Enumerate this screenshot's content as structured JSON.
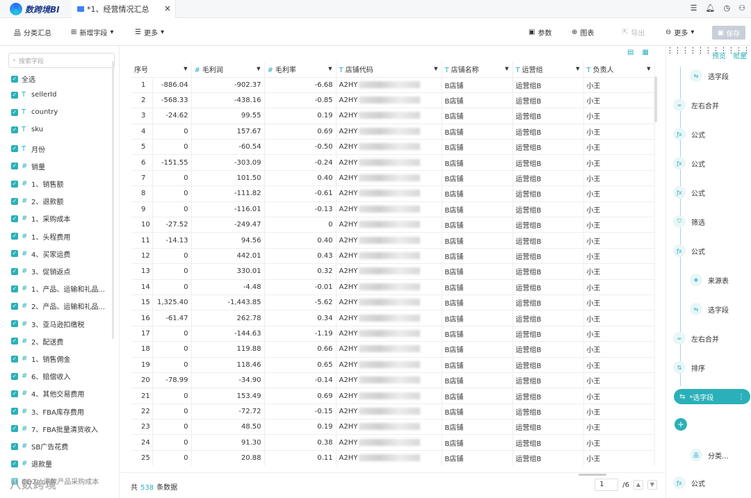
{
  "app": {
    "name": "数跨境BI"
  },
  "tab": {
    "title": "*1、经营情况汇总",
    "close": "×"
  },
  "toolbar": {
    "summary": "分类汇总",
    "add_field": "新增字段",
    "more1": "更多",
    "params": "参数",
    "chart": "图表",
    "export": "导出",
    "more2": "更多",
    "save": "保存"
  },
  "sidebar": {
    "search_placeholder": "搜索字段",
    "select_all": "全选",
    "fields": [
      {
        "type": "T",
        "name": "sellerId"
      },
      {
        "type": "T",
        "name": "country"
      },
      {
        "type": "T",
        "name": "sku"
      },
      {
        "type": "T",
        "name": "月份"
      },
      {
        "type": "#",
        "name": "销量"
      },
      {
        "type": "#",
        "name": "1、销售额"
      },
      {
        "type": "#",
        "name": "2、退款额"
      },
      {
        "type": "#",
        "name": "1、采购成本"
      },
      {
        "type": "#",
        "name": "1、头程费用"
      },
      {
        "type": "#",
        "name": "4、买家运费"
      },
      {
        "type": "#",
        "name": "3、促销返点"
      },
      {
        "type": "#",
        "name": "1、产品、运输和礼品..."
      },
      {
        "type": "#",
        "name": "2、产品、运输和礼品..."
      },
      {
        "type": "#",
        "name": "3、亚马逊扣缴税"
      },
      {
        "type": "#",
        "name": "2、配送费"
      },
      {
        "type": "#",
        "name": "1、销售佣金"
      },
      {
        "type": "#",
        "name": "6、赔偿收入"
      },
      {
        "type": "#",
        "name": "4、其他交易费用"
      },
      {
        "type": "#",
        "name": "3、FBA库存费用"
      },
      {
        "type": "#",
        "name": "7、FBA批量清货收入"
      },
      {
        "type": "#",
        "name": "SB广告花费"
      },
      {
        "type": "#",
        "name": "退款量"
      }
    ],
    "partial_field": "CO2、退款产品采购成本"
  },
  "table": {
    "columns": [
      {
        "type": "",
        "label": "序号"
      },
      {
        "type": "#",
        "label": "毛利润"
      },
      {
        "type": "#",
        "label": "毛利率"
      },
      {
        "type": "T",
        "label": "店铺代码"
      },
      {
        "type": "T",
        "label": "店铺名称"
      },
      {
        "type": "T",
        "label": "运营组"
      },
      {
        "type": "T",
        "label": "负责人"
      }
    ],
    "rows": [
      [
        "1",
        "-886.04",
        "-902.37",
        "-6.68",
        "A2HY",
        "B店铺",
        "运营组B",
        "小王"
      ],
      [
        "2",
        "-568.33",
        "-438.16",
        "-0.85",
        "A2HY",
        "B店铺",
        "运营组B",
        "小王"
      ],
      [
        "3",
        "-24.62",
        "99.55",
        "0.19",
        "A2HY",
        "B店铺",
        "运营组B",
        "小王"
      ],
      [
        "4",
        "0",
        "157.67",
        "0.69",
        "A2HY",
        "B店铺",
        "运营组B",
        "小王"
      ],
      [
        "5",
        "0",
        "-60.54",
        "-0.50",
        "A2HY",
        "B店铺",
        "运营组B",
        "小王"
      ],
      [
        "6",
        "-151.55",
        "-303.09",
        "-0.24",
        "A2HY",
        "B店铺",
        "运营组B",
        "小王"
      ],
      [
        "7",
        "0",
        "101.50",
        "0.40",
        "A2HY",
        "B店铺",
        "运营组B",
        "小王"
      ],
      [
        "8",
        "0",
        "-111.82",
        "-0.61",
        "A2HY",
        "B店铺",
        "运营组B",
        "小王"
      ],
      [
        "9",
        "0",
        "-116.01",
        "-0.13",
        "A2HY",
        "B店铺",
        "运营组B",
        "小王"
      ],
      [
        "10",
        "-27.52",
        "-249.47",
        "0",
        "A2HY",
        "B店铺",
        "运营组B",
        "小王"
      ],
      [
        "11",
        "-14.13",
        "94.56",
        "0.40",
        "A2HY",
        "B店铺",
        "运营组B",
        "小王"
      ],
      [
        "12",
        "0",
        "442.01",
        "0.43",
        "A2HY",
        "B店铺",
        "运营组B",
        "小王"
      ],
      [
        "13",
        "0",
        "330.01",
        "0.32",
        "A2HY",
        "B店铺",
        "运营组B",
        "小王"
      ],
      [
        "14",
        "0",
        "-4.48",
        "-0.01",
        "A2HY",
        "B店铺",
        "运营组B",
        "小王"
      ],
      [
        "15",
        "1,325.40",
        "-1,443.85",
        "-5.62",
        "A2HY",
        "B店铺",
        "运营组B",
        "小王"
      ],
      [
        "16",
        "-61.47",
        "262.78",
        "0.34",
        "A2HY",
        "B店铺",
        "运营组B",
        "小王"
      ],
      [
        "17",
        "0",
        "-144.63",
        "-1.19",
        "A2HY",
        "B店铺",
        "运营组B",
        "小王"
      ],
      [
        "18",
        "0",
        "119.88",
        "0.66",
        "A2HY",
        "B店铺",
        "运营组B",
        "小王"
      ],
      [
        "19",
        "0",
        "118.46",
        "0.65",
        "A2HY",
        "B店铺",
        "运营组B",
        "小王"
      ],
      [
        "20",
        "-78.99",
        "-34.90",
        "-0.14",
        "A2HY",
        "B店铺",
        "运营组B",
        "小王"
      ],
      [
        "21",
        "0",
        "153.49",
        "0.69",
        "A2HY",
        "B店铺",
        "运营组B",
        "小王"
      ],
      [
        "22",
        "0",
        "-72.72",
        "-0.15",
        "A2HY",
        "B店铺",
        "运营组B",
        "小王"
      ],
      [
        "23",
        "0",
        "48.50",
        "0.19",
        "A2HY",
        "B店铺",
        "运营组B",
        "小王"
      ],
      [
        "24",
        "0",
        "91.30",
        "0.38",
        "A2HY",
        "B店铺",
        "运营组B",
        "小王"
      ],
      [
        "25",
        "0",
        "20.88",
        "0.11",
        "A2HY",
        "B店铺",
        "运营组B",
        "小王"
      ]
    ]
  },
  "footer": {
    "prefix": "共",
    "count": "538",
    "suffix": "条数据",
    "page": "1",
    "total_pages": "/6"
  },
  "right_panel": {
    "tab_preview": "预览",
    "tab_batch": "批量",
    "steps": [
      {
        "label": "选字段",
        "icon": "select-fields-icon"
      },
      {
        "label": "左右合并",
        "icon": "merge-icon"
      },
      {
        "label": "公式",
        "icon": "formula-icon"
      },
      {
        "label": "公式",
        "icon": "formula-icon"
      },
      {
        "label": "公式",
        "icon": "formula-icon"
      },
      {
        "label": "筛选",
        "icon": "filter-icon"
      },
      {
        "label": "公式",
        "icon": "formula-icon"
      },
      {
        "label": "来源表",
        "icon": "source-icon"
      },
      {
        "label": "选字段",
        "icon": "select-fields-icon"
      },
      {
        "label": "左右合并",
        "icon": "merge-icon"
      },
      {
        "label": "排序",
        "icon": "sort-icon"
      },
      {
        "label": "*选字段",
        "icon": "select-fields-icon"
      },
      {
        "label": "分类...",
        "icon": "group-icon"
      },
      {
        "label": "公式",
        "icon": "formula-icon"
      }
    ]
  },
  "watermark": "八数跨境",
  "colors": {
    "accent": "#2ab0b8",
    "logo": "#1e3a8a"
  }
}
